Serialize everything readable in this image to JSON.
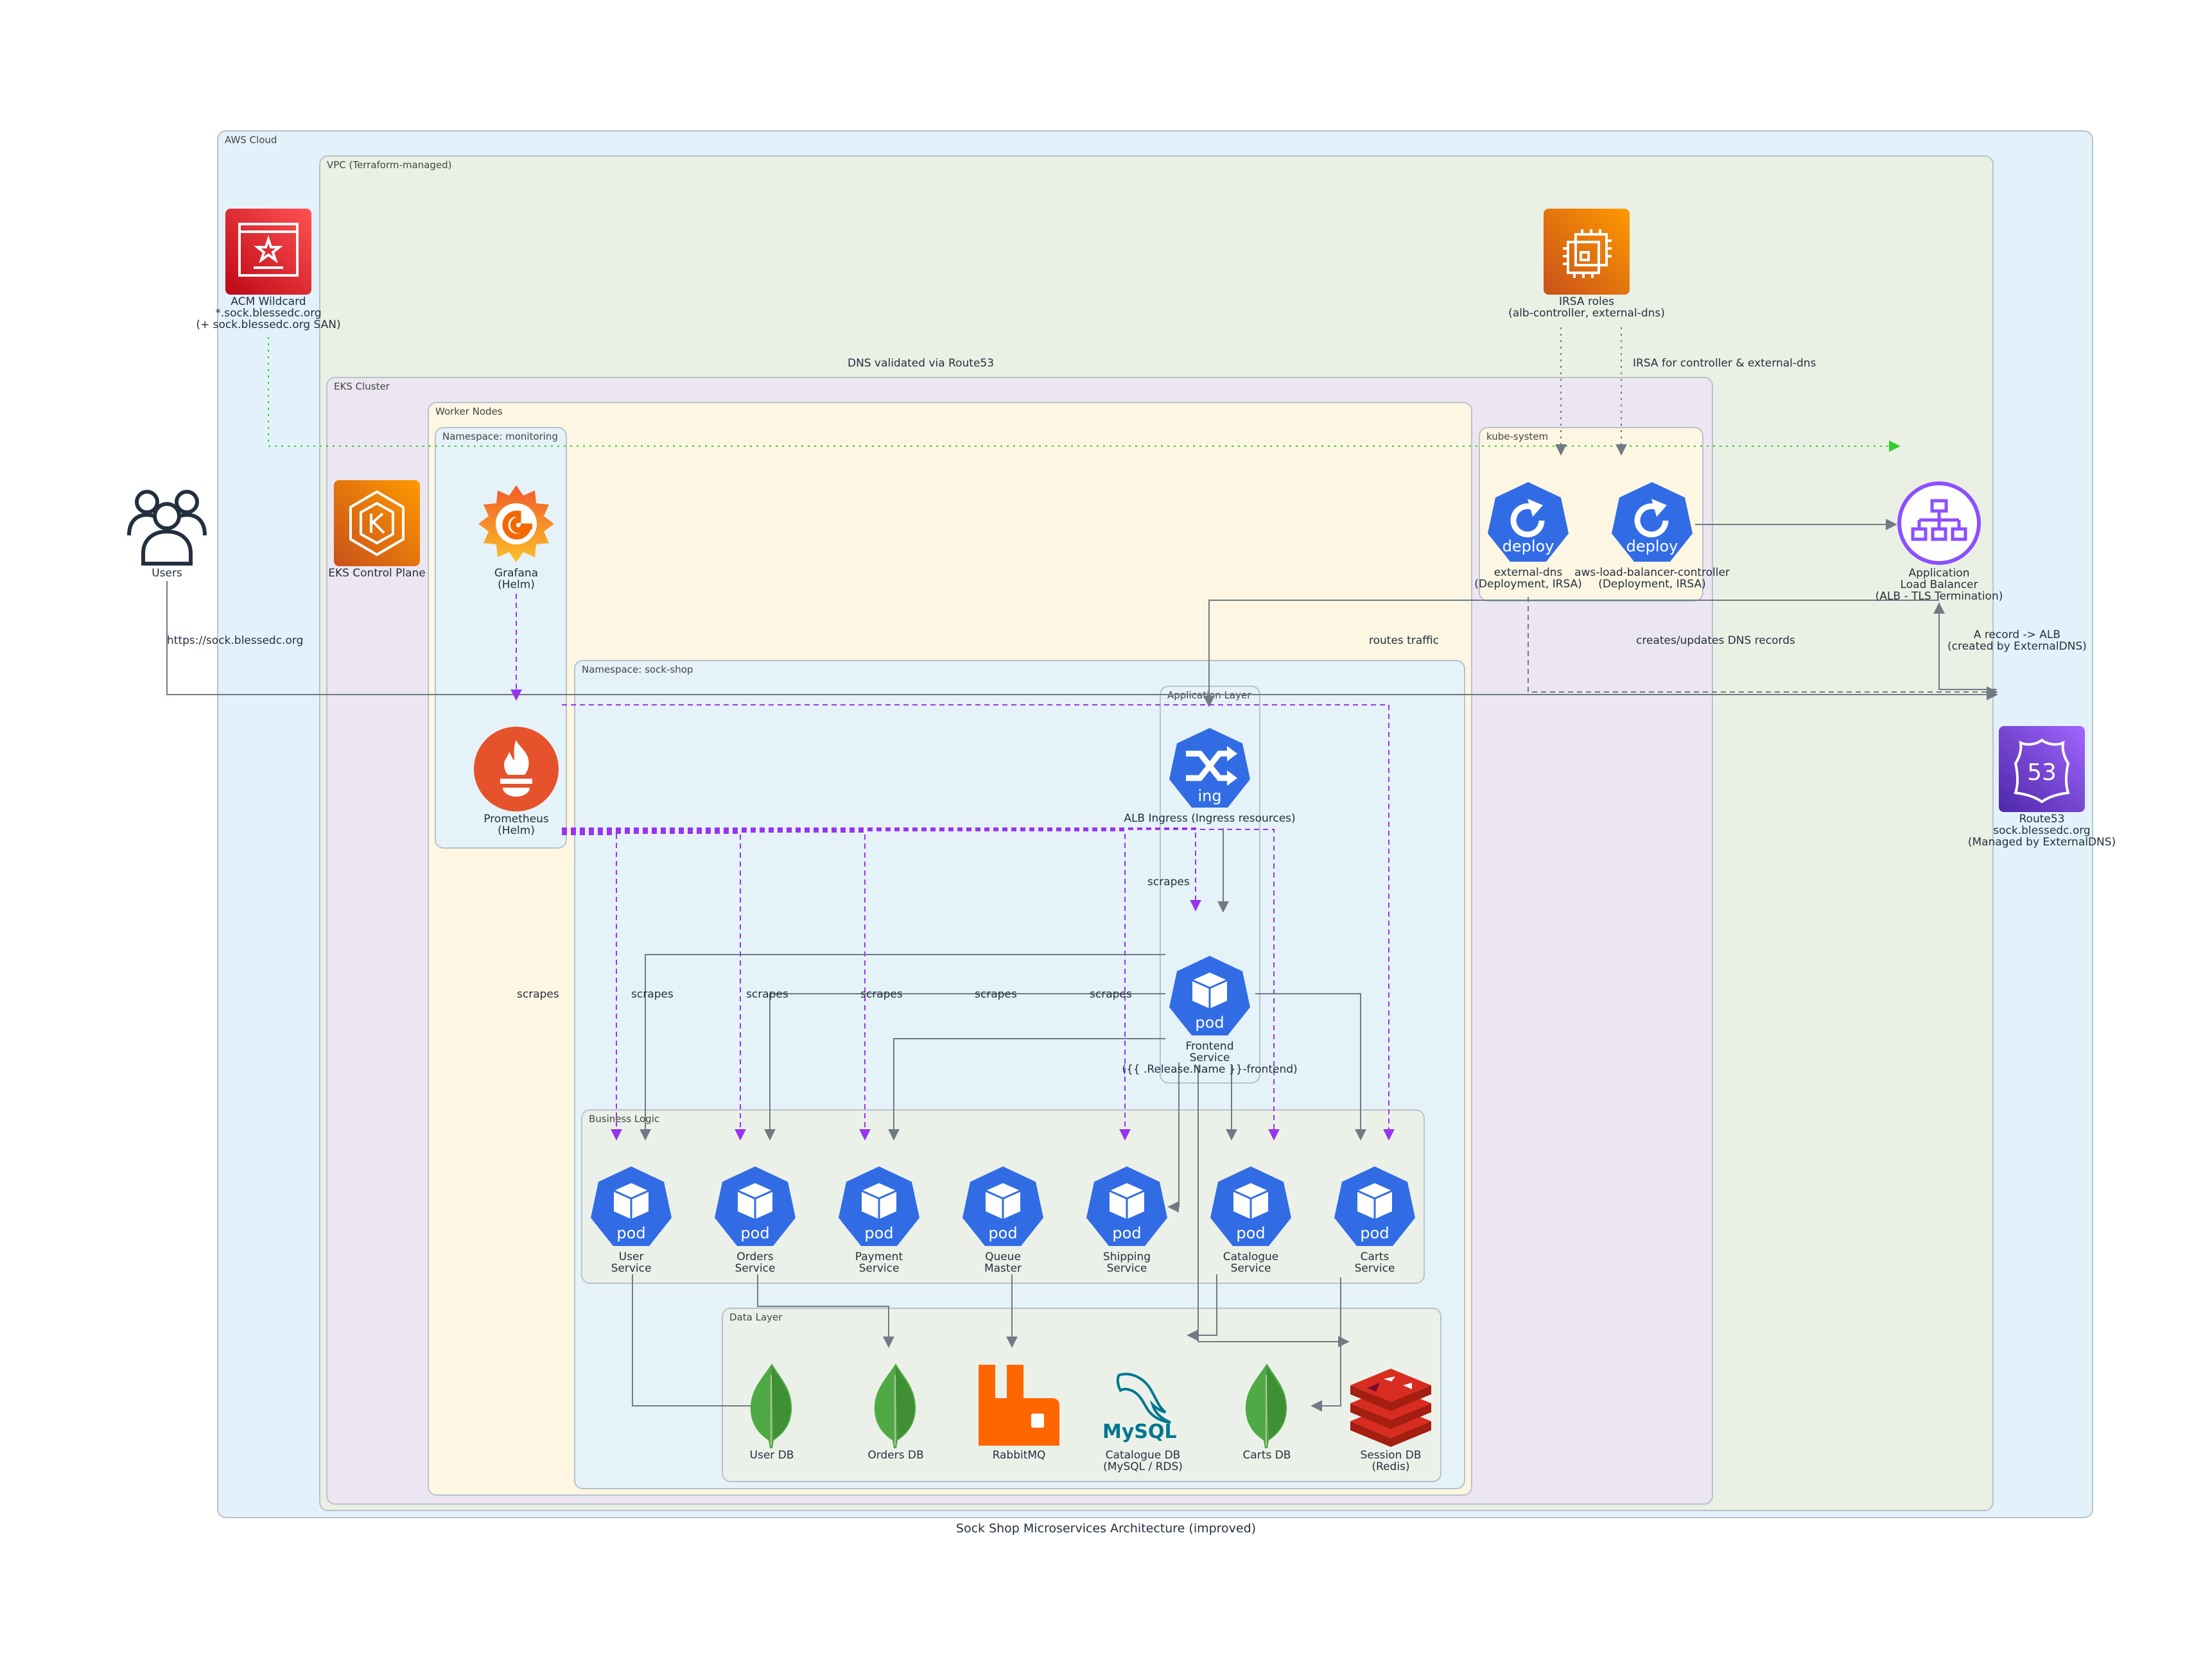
{
  "title": "Sock Shop Microservices Architecture (improved)",
  "colors": {
    "aws_cloud": "#e3f2fa",
    "vpc": "#eaf1e4",
    "eks": "#ebe6f1",
    "worker": "#fcf6e2",
    "monitoring_ns": "#e5f2f8",
    "sockshop_ns": "#e5f2f8",
    "layer": "#ebf1e8",
    "k8s_blue": "#326ce5",
    "scrape_purple": "#9933ee",
    "green_dotted": "#33cc33",
    "edge_gray": "#707a85"
  },
  "clusters": {
    "aws_cloud": "AWS Cloud",
    "vpc": "VPC (Terraform-managed)",
    "eks": "EKS Cluster",
    "worker": "Worker Nodes",
    "monitoring": "Namespace: monitoring",
    "kube_system": "kube-system",
    "sock_shop": "Namespace: sock-shop",
    "app_layer": "Application Layer",
    "business": "Business Logic",
    "data": "Data Layer"
  },
  "nodes": {
    "users": {
      "label": "Users",
      "icon": "users-icon"
    },
    "acm": {
      "label": "ACM Wildcard\n*.sock.blessedc.org\n(+ sock.blessedc.org SAN)",
      "icon": "certificate-manager-icon"
    },
    "irsa": {
      "label": "IRSA roles\n(alb-controller, external-dns)",
      "icon": "iam-role-chip-icon"
    },
    "eks_cp": {
      "label": "EKS Control Plane",
      "icon": "eks-icon"
    },
    "grafana": {
      "label": "Grafana\n(Helm)",
      "icon": "grafana-icon"
    },
    "prometheus": {
      "label": "Prometheus\n(Helm)",
      "icon": "prometheus-icon"
    },
    "external_dns": {
      "label": "external-dns\n(Deployment, IRSA)",
      "icon": "k8s-deploy-icon",
      "badge": "deploy"
    },
    "alb_ctrl": {
      "label": "aws-load-balancer-controller\n(Deployment, IRSA)",
      "icon": "k8s-deploy-icon",
      "badge": "deploy"
    },
    "alb": {
      "label": "Application\nLoad Balancer\n(ALB - TLS Termination)",
      "icon": "load-balancer-icon"
    },
    "route53": {
      "label": "Route53\nsock.blessedc.org\n(Managed by ExternalDNS)",
      "icon": "route53-icon"
    },
    "ingress": {
      "label": "ALB Ingress (Ingress resources)",
      "icon": "k8s-ingress-icon",
      "badge": "ing"
    },
    "frontend": {
      "label": "Frontend\nService\n({{ .Release.Name }}-frontend)",
      "icon": "k8s-pod-icon",
      "badge": "pod"
    },
    "user_svc": {
      "label": "User\nService",
      "icon": "k8s-pod-icon",
      "badge": "pod"
    },
    "orders_svc": {
      "label": "Orders\nService",
      "icon": "k8s-pod-icon",
      "badge": "pod"
    },
    "payment_svc": {
      "label": "Payment\nService",
      "icon": "k8s-pod-icon",
      "badge": "pod"
    },
    "queue_master": {
      "label": "Queue\nMaster",
      "icon": "k8s-pod-icon",
      "badge": "pod"
    },
    "shipping_svc": {
      "label": "Shipping\nService",
      "icon": "k8s-pod-icon",
      "badge": "pod"
    },
    "catalogue_svc": {
      "label": "Catalogue\nService",
      "icon": "k8s-pod-icon",
      "badge": "pod"
    },
    "carts_svc": {
      "label": "Carts\nService",
      "icon": "k8s-pod-icon",
      "badge": "pod"
    },
    "user_db": {
      "label": "User DB",
      "icon": "mongodb-leaf-icon"
    },
    "orders_db": {
      "label": "Orders DB",
      "icon": "mongodb-leaf-icon"
    },
    "rabbitmq": {
      "label": "RabbitMQ",
      "icon": "rabbitmq-icon"
    },
    "catalogue_db": {
      "label": "Catalogue DB\n(MySQL / RDS)",
      "icon": "mysql-icon",
      "wordmark": "MySQL"
    },
    "carts_db": {
      "label": "Carts DB",
      "icon": "mongodb-leaf-icon"
    },
    "session_db": {
      "label": "Session DB\n(Redis)",
      "icon": "redis-icon"
    }
  },
  "edge_labels": {
    "dns_validated": "DNS validated via Route53",
    "irsa_for": "IRSA for controller & external-dns",
    "users_url": "https://sock.blessedc.org",
    "routes_traffic": "routes traffic",
    "creates_dns": "creates/updates DNS records",
    "a_record": "A record -> ALB\n(created by ExternalDNS)",
    "scrapes": "scrapes"
  }
}
